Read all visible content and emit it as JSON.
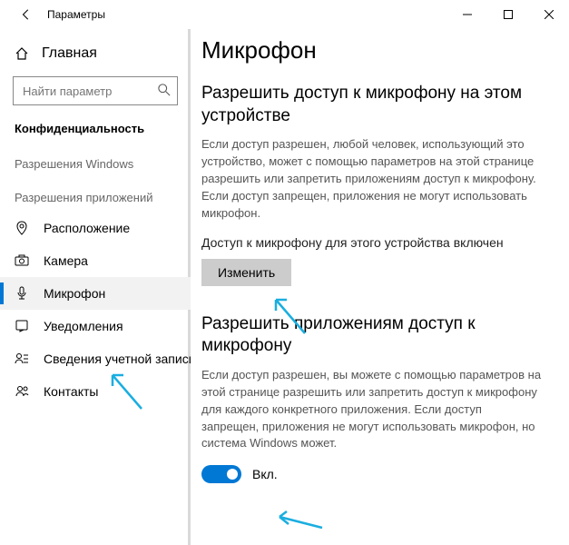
{
  "window": {
    "title": "Параметры"
  },
  "sidebar": {
    "home": "Главная",
    "search_placeholder": "Найти параметр",
    "category": "Конфиденциальность",
    "group1": "Разрешения Windows",
    "group2": "Разрешения приложений",
    "items": [
      "Расположение",
      "Камера",
      "Микрофон",
      "Уведомления",
      "Сведения учетной записи",
      "Контакты"
    ]
  },
  "main": {
    "title": "Микрофон",
    "sec1_title": "Разрешить доступ к микрофону на этом устройстве",
    "sec1_desc": "Если доступ разрешен, любой человек, использующий это устройство, может с помощью параметров на этой странице разрешить или запретить приложениям доступ к микрофону. Если доступ запрещен, приложения не могут использовать микрофон.",
    "status": "Доступ к микрофону для этого устройства включен",
    "change_btn": "Изменить",
    "sec2_title": "Разрешить приложениям доступ к микрофону",
    "sec2_desc": "Если доступ разрешен, вы можете с помощью параметров на этой странице разрешить или запретить доступ к микрофону для каждого конкретного приложения. Если доступ запрещен, приложения не могут использовать микрофон, но система Windows может.",
    "toggle_label": "Вкл."
  }
}
